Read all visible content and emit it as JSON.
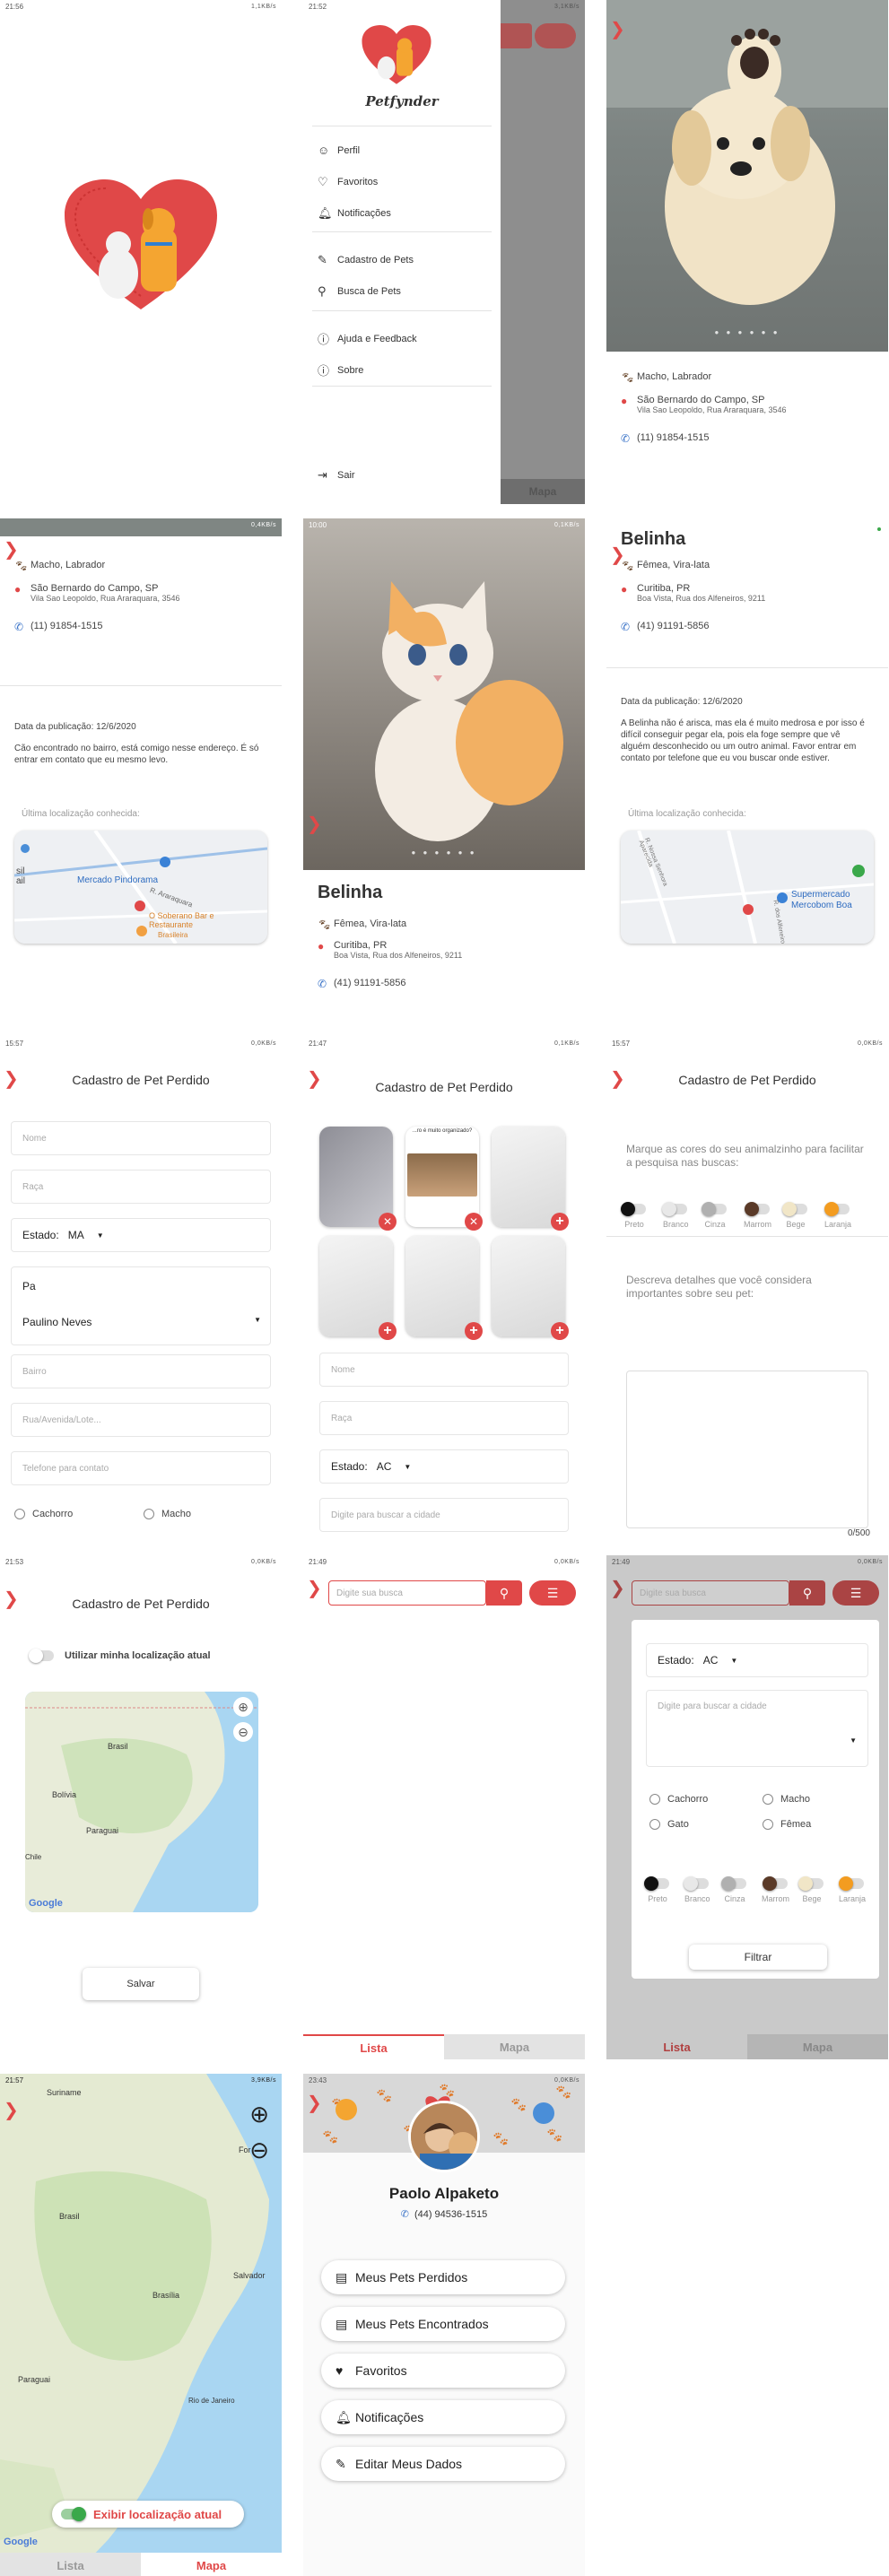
{
  "status_bar": {
    "s1_time": "21:56",
    "s1_right": "1,1KB/s",
    "s2_time": "21:52",
    "s2_right": "3,1KB/s",
    "s4_right": "0,4KB/s",
    "s5_time": "10:00",
    "s5_right": "0,1KB/s",
    "s7_time": "15:57",
    "s7_right": "0,0KB/s",
    "s8_time": "21:47",
    "s8_right": "0,1KB/s",
    "s9_time": "15:57",
    "s9_right": "0,0KB/s",
    "s10_time": "21:53",
    "s10_right": "0,0KB/s",
    "s11_time": "21:49",
    "s11_right": "0,0KB/s",
    "s12_time": "21:49",
    "s12_right": "0,0KB/s",
    "s13_time": "21:57",
    "s13_right": "3,9KB/s",
    "s14_time": "23:43",
    "s14_right": "0,0KB/s"
  },
  "menu": {
    "brand": "Petfynder",
    "items": [
      "Perfil",
      "Favoritos",
      "Notificações",
      "Cadastro de Pets",
      "Busca de Pets",
      "Ajuda e Feedback",
      "Sobre",
      "Sair"
    ],
    "map_label": "Mapa"
  },
  "pet_dog": {
    "sex_breed": "Macho, Labrador",
    "city": "São Bernardo do Campo, SP",
    "address": "Vila Sao Leopoldo, Rua Araraquara, 3546",
    "phone": "(11) 91854-1515",
    "date": "Data da publicação: 12/6/2020",
    "description": "Cão encontrado no bairro, está comigo nesse endereço. É só entrar em contato que eu mesmo levo.",
    "last_location": "Última localização conhecida:",
    "map_place1": "Mercado Pindorama",
    "map_place2": "O Soberano Bar e Restaurante",
    "map_place2b": "Brasileira",
    "map_street": "R. Araraquara",
    "map_side": "sil ail"
  },
  "pet_cat": {
    "name": "Belinha",
    "sex_breed": "Fêmea, Vira-lata",
    "city": "Curitiba, PR",
    "address": "Boa Vista, Rua dos Alfeneiros, 9211",
    "phone": "(41) 91191-5856",
    "date": "Data da publicação: 12/6/2020",
    "description": "A Belinha não é arisca, mas ela é muito medrosa e por isso é difícil conseguir pegar ela, pois ela foge sempre que vê alguém desconhecido ou um outro animal. Favor entrar em contato por telefone que eu vou buscar onde estiver.",
    "last_location": "Última localização conhecida:",
    "map_place": "Supermercado Mercobom Boa",
    "map_street1": "R. Nossa Senhora Aparecida",
    "map_street2": "R. dos Alfeneiros"
  },
  "form": {
    "title": "Cadastro de Pet Perdido",
    "nome": "Nome",
    "raca": "Raça",
    "estado_label": "Estado:",
    "estado_ma": "MA",
    "estado_ac": "AC",
    "city_typed": "Pa",
    "city_suggestion": "Paulino Neves",
    "bairro": "Bairro",
    "rua": "Rua/Avenida/Lote...",
    "telefone": "Telefone para contato",
    "cachorro": "Cachorro",
    "macho": "Macho",
    "cidade_placeholder": "Digite para buscar a cidade",
    "photo_caption": "...ro é muito organizado?",
    "colors_prompt": "Marque as cores do seu animalzinho para facilitar a pesquisa nas buscas:",
    "colors": [
      "Preto",
      "Branco",
      "Cinza",
      "Marrom",
      "Bege",
      "Laranja"
    ],
    "details_prompt": "Descreva detalhes que você considera importantes sobre seu pet:",
    "counter": "0/500",
    "use_location": "Utilizar minha localização atual",
    "save": "Salvar",
    "map_labels": [
      "Brasil",
      "Bolívia",
      "Paraguai",
      "Chile"
    ],
    "google": "Google"
  },
  "search": {
    "placeholder": "Digite sua busca",
    "tab_list": "Lista",
    "tab_map": "Mapa",
    "gato": "Gato",
    "femea": "Fêmea",
    "filter_btn": "Filtrar"
  },
  "bigmap": {
    "labels": [
      "Suriname",
      "Brasil",
      "Paraguai",
      "Salvador",
      "Brasília",
      "Rio de Janeiro",
      "Fortaleza"
    ],
    "label_for": "For",
    "toggle": "Exibir localização atual"
  },
  "profile": {
    "name": "Paolo Alpaketo",
    "phone": "(44) 94536-1515",
    "items": [
      "Meus Pets Perdidos",
      "Meus Pets Encontrados",
      "Favoritos",
      "Notificações",
      "Editar Meus Dados"
    ]
  },
  "colors": {
    "accent": "#e04848",
    "swatches": [
      "#111111",
      "#e8e8e8",
      "#b0b0b0",
      "#5a3a28",
      "#f1e6c7",
      "#f39c20"
    ]
  }
}
